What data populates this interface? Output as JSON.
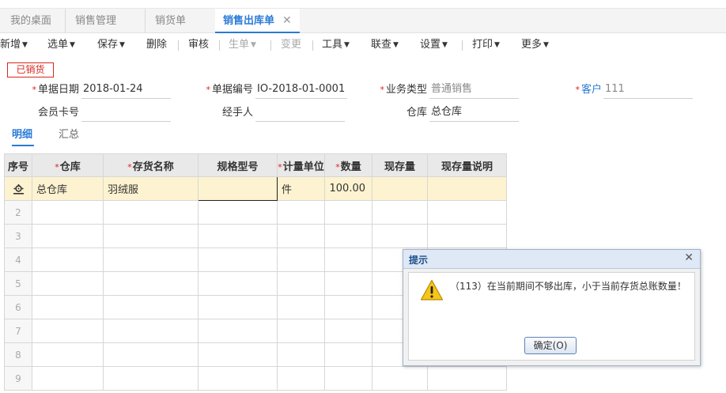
{
  "tabs": [
    {
      "label": "我的桌面"
    },
    {
      "label": "销售管理"
    },
    {
      "label": "销货单"
    },
    {
      "label": "销售出库单",
      "active": true
    }
  ],
  "tab_close_glyph": "✕",
  "toolbar": {
    "new": "新增",
    "select": "选单",
    "save": "保存",
    "delete": "删除",
    "audit": "审核",
    "generate": "生单",
    "change": "变更",
    "tools": "工具",
    "linked_query": "联查",
    "settings": "设置",
    "print": "打印",
    "more": "更多"
  },
  "status_badge": "已销货",
  "form": {
    "doc_date_label": "单据日期",
    "doc_date": "2018-01-24",
    "doc_no_label": "单据编号",
    "doc_no": "IO-2018-01-0001",
    "biz_type_label": "业务类型",
    "biz_type": "普通销售",
    "customer_label": "客户",
    "customer": "111",
    "member_card_label": "会员卡号",
    "member_card": "",
    "handler_label": "经手人",
    "handler": "",
    "warehouse_label": "仓库",
    "warehouse": "总仓库"
  },
  "detail_tabs": {
    "detail": "明细",
    "summary": "汇总"
  },
  "grid": {
    "headers": {
      "seq": "序号",
      "warehouse": "仓库",
      "item_name": "存货名称",
      "spec": "规格型号",
      "unit": "计量单位",
      "qty": "数量",
      "stock": "现存量",
      "stock_note": "现存量说明"
    },
    "row1": {
      "warehouse": "总仓库",
      "item_name": "羽绒服",
      "spec": "",
      "unit": "件",
      "qty": "100.00",
      "stock": "",
      "stock_note": ""
    },
    "row_numbers": [
      "2",
      "3",
      "4",
      "5",
      "6",
      "7",
      "8",
      "9"
    ]
  },
  "dialog": {
    "title": "提示",
    "close_glyph": "✕",
    "message": "（113）在当前期间不够出库，小于当前存货总账数量！",
    "ok_button": "确定(O)"
  },
  "colors": {
    "accent": "#2a7ad8",
    "required": "#e02020",
    "badge": "#d9261c",
    "selected_row": "#fdf3d0",
    "warning": "#f5c518"
  }
}
